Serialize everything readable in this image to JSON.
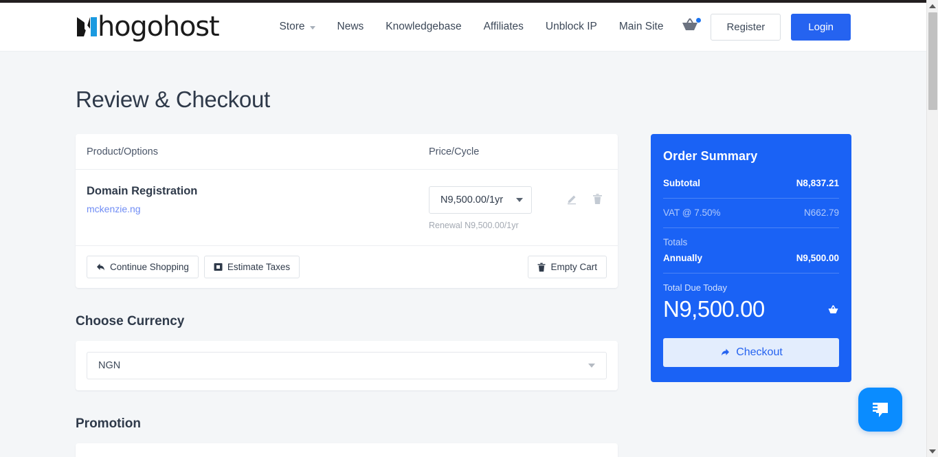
{
  "header": {
    "logo_text": "hogohost",
    "logo_icon": "whogohost-w-logo",
    "nav": [
      {
        "label": "Store",
        "has_caret": true
      },
      {
        "label": "News",
        "has_caret": false
      },
      {
        "label": "Knowledgebase",
        "has_caret": false
      },
      {
        "label": "Affiliates",
        "has_caret": false
      },
      {
        "label": "Unblock IP",
        "has_caret": false
      },
      {
        "label": "Main Site",
        "has_caret": false
      }
    ],
    "cart_icon": "shopping-basket-icon",
    "register_label": "Register",
    "login_label": "Login",
    "accent_color": "#2563f0"
  },
  "main": {
    "page_title": "Review & Checkout",
    "cart": {
      "columns": [
        "Product/Options",
        "Price/Cycle"
      ],
      "rows": [
        {
          "product": "Domain Registration",
          "domain": "mckenzie.ng",
          "price_cycle": "N9,500.00/1yr",
          "renewal": "Renewal N9,500.00/1yr",
          "edit_icon": "pencil-icon",
          "delete_icon": "trash-icon"
        }
      ],
      "actions": {
        "continue_shopping": "Continue Shopping",
        "continue_shopping_icon": "arrow-back-icon",
        "estimate_taxes": "Estimate Taxes",
        "estimate_taxes_icon": "calculator-icon",
        "empty_cart": "Empty Cart",
        "empty_cart_icon": "trash-icon"
      }
    },
    "currency": {
      "section_title": "Choose Currency",
      "selected": "NGN",
      "options": [
        "NGN"
      ]
    },
    "promotion": {
      "section_title": "Promotion"
    }
  },
  "summary": {
    "title": "Order Summary",
    "subtotal_label": "Subtotal",
    "subtotal_value": "N8,837.21",
    "vat_label": "VAT @ 7.50%",
    "vat_value": "N662.79",
    "totals_label": "Totals",
    "annually_label": "Annually",
    "annually_value": "N9,500.00",
    "due_label": "Total Due Today",
    "due_amount": "N9,500.00",
    "due_icon": "basket-icon",
    "checkout_label": "Checkout",
    "checkout_icon": "arrow-forward-icon",
    "panel_color": "#1a62f5",
    "checkout_bg_color": "#e3edfd"
  },
  "chat": {
    "icon": "chat-bubble-icon",
    "color": "#0a8cff"
  },
  "scrollbar": {
    "up_icon": "scroll-up-arrow",
    "down_icon": "scroll-down-arrow"
  }
}
